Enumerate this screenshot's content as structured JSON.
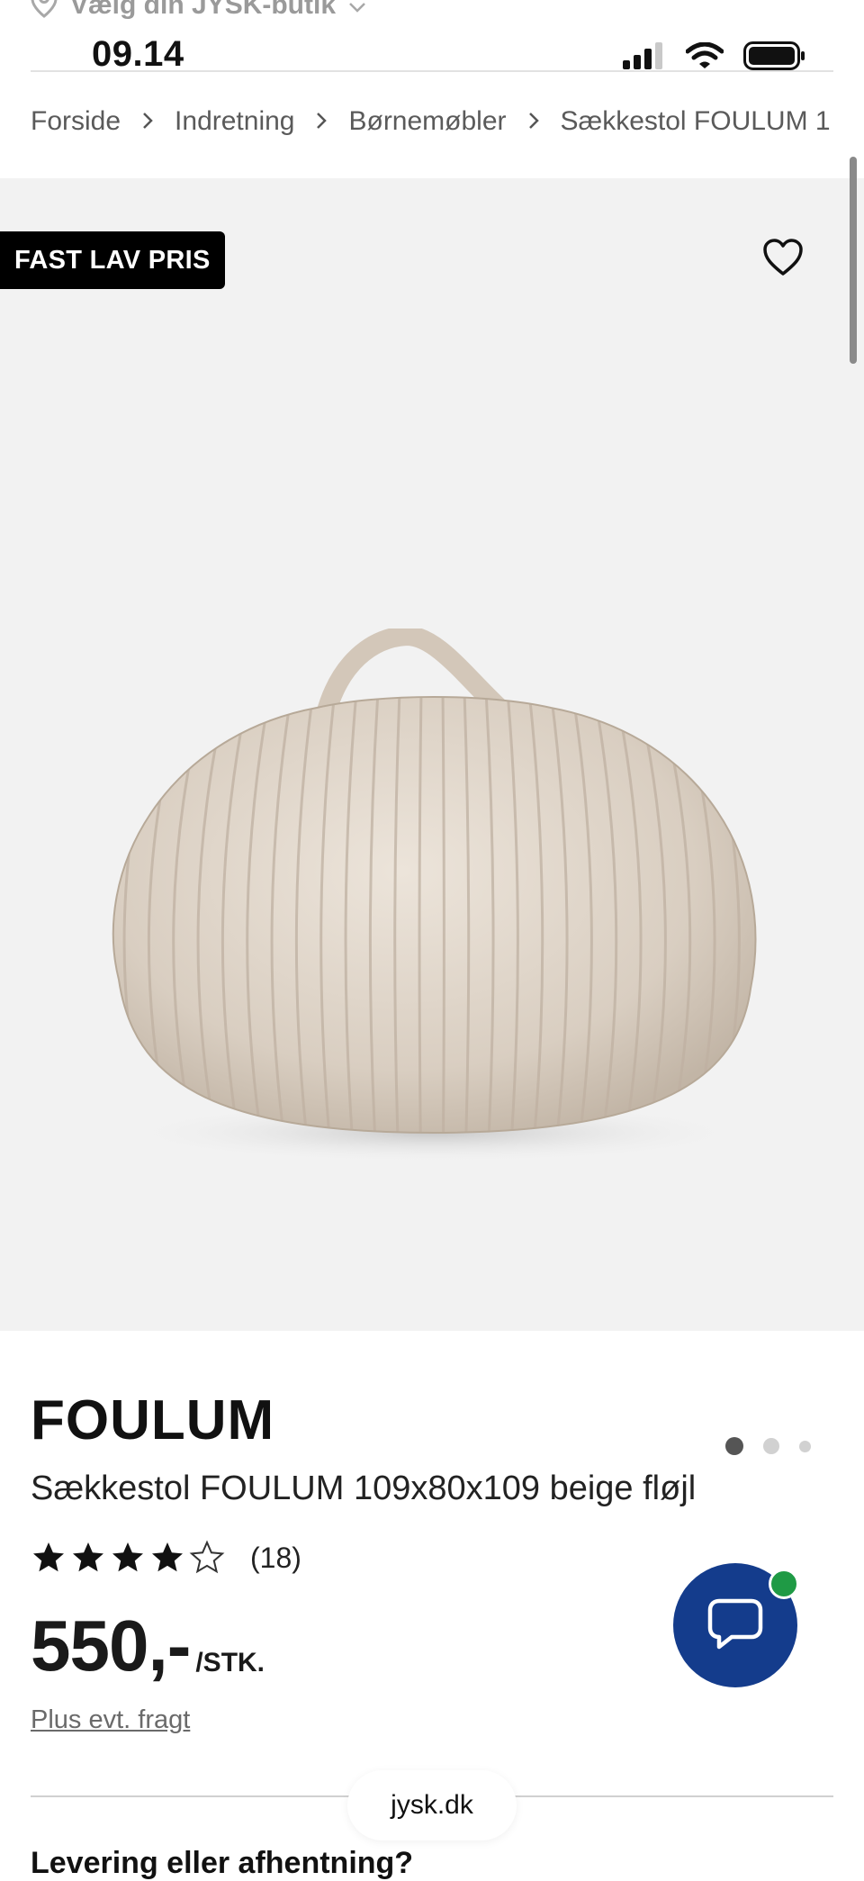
{
  "store_selector": {
    "label": "Vælg din JYSK-butik"
  },
  "status_bar": {
    "time": "09.14"
  },
  "breadcrumb": [
    "Forside",
    "Indretning",
    "Børnemøbler",
    "Sækkestol FOULUM 1"
  ],
  "gallery": {
    "badge": "FAST LAV PRIS",
    "image_count": 3,
    "active_image_index": 0
  },
  "product": {
    "brand": "FOULUM",
    "name": "Sækkestol FOULUM 109x80x109 beige fløjl",
    "rating": {
      "value": 4,
      "max": 5,
      "count": "(18)"
    },
    "price": "550,-",
    "unit": "/STK.",
    "freight_note": "Plus evt. fragt"
  },
  "delivery": {
    "heading": "Levering eller afhentning?"
  },
  "browser": {
    "url": "jysk.dk"
  },
  "colors": {
    "chat_button": "#143c8c",
    "chat_online": "#1f9a45",
    "badge_bg": "#000000"
  },
  "icons": [
    "location-pin-icon",
    "chevron-down-icon",
    "signal-icon",
    "wifi-icon",
    "battery-icon",
    "chevron-right-icon",
    "heart-icon",
    "star-icon",
    "chat-icon"
  ]
}
